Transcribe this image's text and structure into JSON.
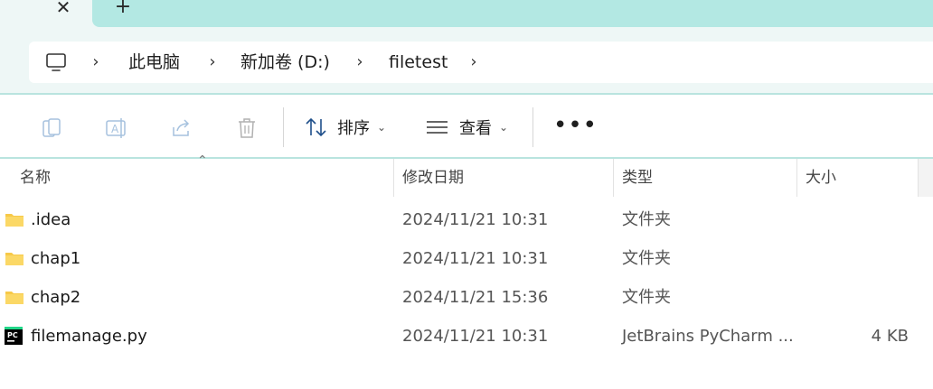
{
  "tabs": {
    "close_glyph": "✕",
    "new_tab_glyph": "+"
  },
  "address": {
    "root_icon": "this-pc-icon",
    "separator": "›",
    "crumbs": [
      "此电脑",
      "新加卷 (D:)",
      "filetest"
    ]
  },
  "toolbar": {
    "icons": [
      "copy-icon",
      "rename-icon",
      "share-icon",
      "delete-icon"
    ],
    "sort_label": "排序",
    "view_label": "查看",
    "chevron": "⌄",
    "more_glyph": "•••"
  },
  "columns": {
    "name": "名称",
    "modified": "修改日期",
    "type": "类型",
    "size": "大小"
  },
  "files": [
    {
      "name": ".idea",
      "modified": "2024/11/21 10:31",
      "type": "文件夹",
      "size": "",
      "icon": "folder-icon"
    },
    {
      "name": "chap1",
      "modified": "2024/11/21 10:31",
      "type": "文件夹",
      "size": "",
      "icon": "folder-icon"
    },
    {
      "name": "chap2",
      "modified": "2024/11/21 15:36",
      "type": "文件夹",
      "size": "",
      "icon": "folder-icon"
    },
    {
      "name": "filemanage.py",
      "modified": "2024/11/21 10:31",
      "type": "JetBrains PyCharm ...",
      "size": "4 KB",
      "icon": "pycharm-file-icon"
    }
  ],
  "colors": {
    "tab_strip": "#b3e8e3",
    "title_bg": "#eef7f6",
    "folder": "#f7c948",
    "accent_divider": "#b9e4df"
  }
}
